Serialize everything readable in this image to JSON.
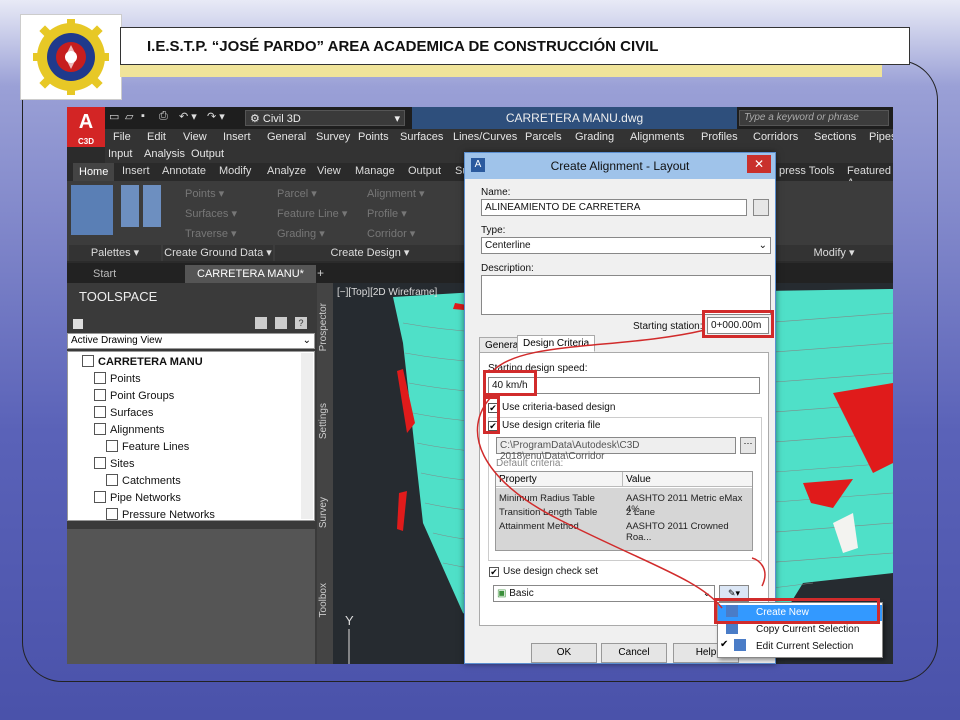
{
  "header": {
    "title": "I.E.S.T.P. “JOSÉ PARDO” AREA ACADEMICA DE CONSTRUCCIÓN CIVIL"
  },
  "app": {
    "logo_letter": "A",
    "logo_sub": "C3D",
    "workspace": "Civil 3D",
    "document": "CARRETERA MANU.dwg",
    "search_placeholder": "Type a keyword or phrase"
  },
  "menu": [
    "File",
    "Edit",
    "View",
    "Insert",
    "General",
    "Survey",
    "Points",
    "Surfaces",
    "Lines/Curves",
    "Parcels",
    "Grading",
    "Alignments",
    "Profiles",
    "Corridors",
    "Sections",
    "Pipes"
  ],
  "menu2": [
    "Input",
    "Analysis",
    "Output"
  ],
  "ribbon_tabs": [
    "Home",
    "Insert",
    "Annotate",
    "Modify",
    "Analyze",
    "View",
    "Manage",
    "Output",
    "Su"
  ],
  "ribbon_tabs_right": [
    "press Tools",
    "Featured A"
  ],
  "ribbon_groups": [
    "Palettes ▾",
    "Create Ground Data ▾",
    "Create Design ▾",
    "Modify ▾"
  ],
  "ribbon_buttons": [
    "Points ▾",
    "Surfaces ▾",
    "Traverse ▾",
    "Parcel ▾",
    "Feature Line ▾",
    "Grading ▾",
    "Alignment ▾",
    "Profile ▾",
    "Corridor ▾"
  ],
  "doc_tabs": [
    "Start",
    "CARRETERA MANU*"
  ],
  "toolspace": {
    "title": "TOOLSPACE",
    "view": "Active Drawing View",
    "root": "CARRETERA MANU",
    "items": [
      "Points",
      "Point Groups",
      "Surfaces",
      "Alignments",
      "Feature Lines",
      "Sites",
      "Catchments",
      "Pipe Networks",
      "Pressure Networks"
    ],
    "side_tabs": [
      "Prospector",
      "Settings",
      "Survey",
      "Toolbox"
    ]
  },
  "viewport": {
    "label": "[−][Top][2D Wireframe]",
    "axis": "Y"
  },
  "dialog": {
    "title": "Create Alignment - Layout",
    "name_label": "Name:",
    "name_value": "ALINEAMIENTO DE CARRETERA",
    "type_label": "Type:",
    "type_value": "Centerline",
    "description_label": "Description:",
    "starting_station_label": "Starting station:",
    "starting_station_value": "0+000.00m",
    "tabs": [
      "General",
      "Design Criteria"
    ],
    "speed_label": "Starting design speed:",
    "speed_value": "40 km/h",
    "use_criteria_label": "Use criteria-based design",
    "use_criteria_checked": true,
    "use_file_label": "Use design criteria file",
    "use_file_checked": true,
    "file_path": "C:\\ProgramData\\Autodesk\\C3D 2018\\enu\\Data\\Corridor",
    "default_criteria_label": "Default criteria:",
    "grid_headers": [
      "Property",
      "Value"
    ],
    "grid_rows": [
      [
        "Minimum Radius Table",
        "AASHTO 2011 Metric eMax 4%"
      ],
      [
        "Transition Length Table",
        "2 Lane"
      ],
      [
        "Attainment Method",
        "AASHTO 2011 Crowned Roa..."
      ]
    ],
    "use_check_set_label": "Use design check set",
    "use_check_set_checked": true,
    "check_set_value": "Basic",
    "buttons": [
      "OK",
      "Cancel",
      "Help"
    ]
  },
  "dropdown_menu": [
    "Create New",
    "Copy Current Selection",
    "Edit Current Selection"
  ],
  "colors": {
    "highlight": "#d12b2b",
    "terrain": "#4fe0c8",
    "accent_red": "#e01b1b"
  }
}
